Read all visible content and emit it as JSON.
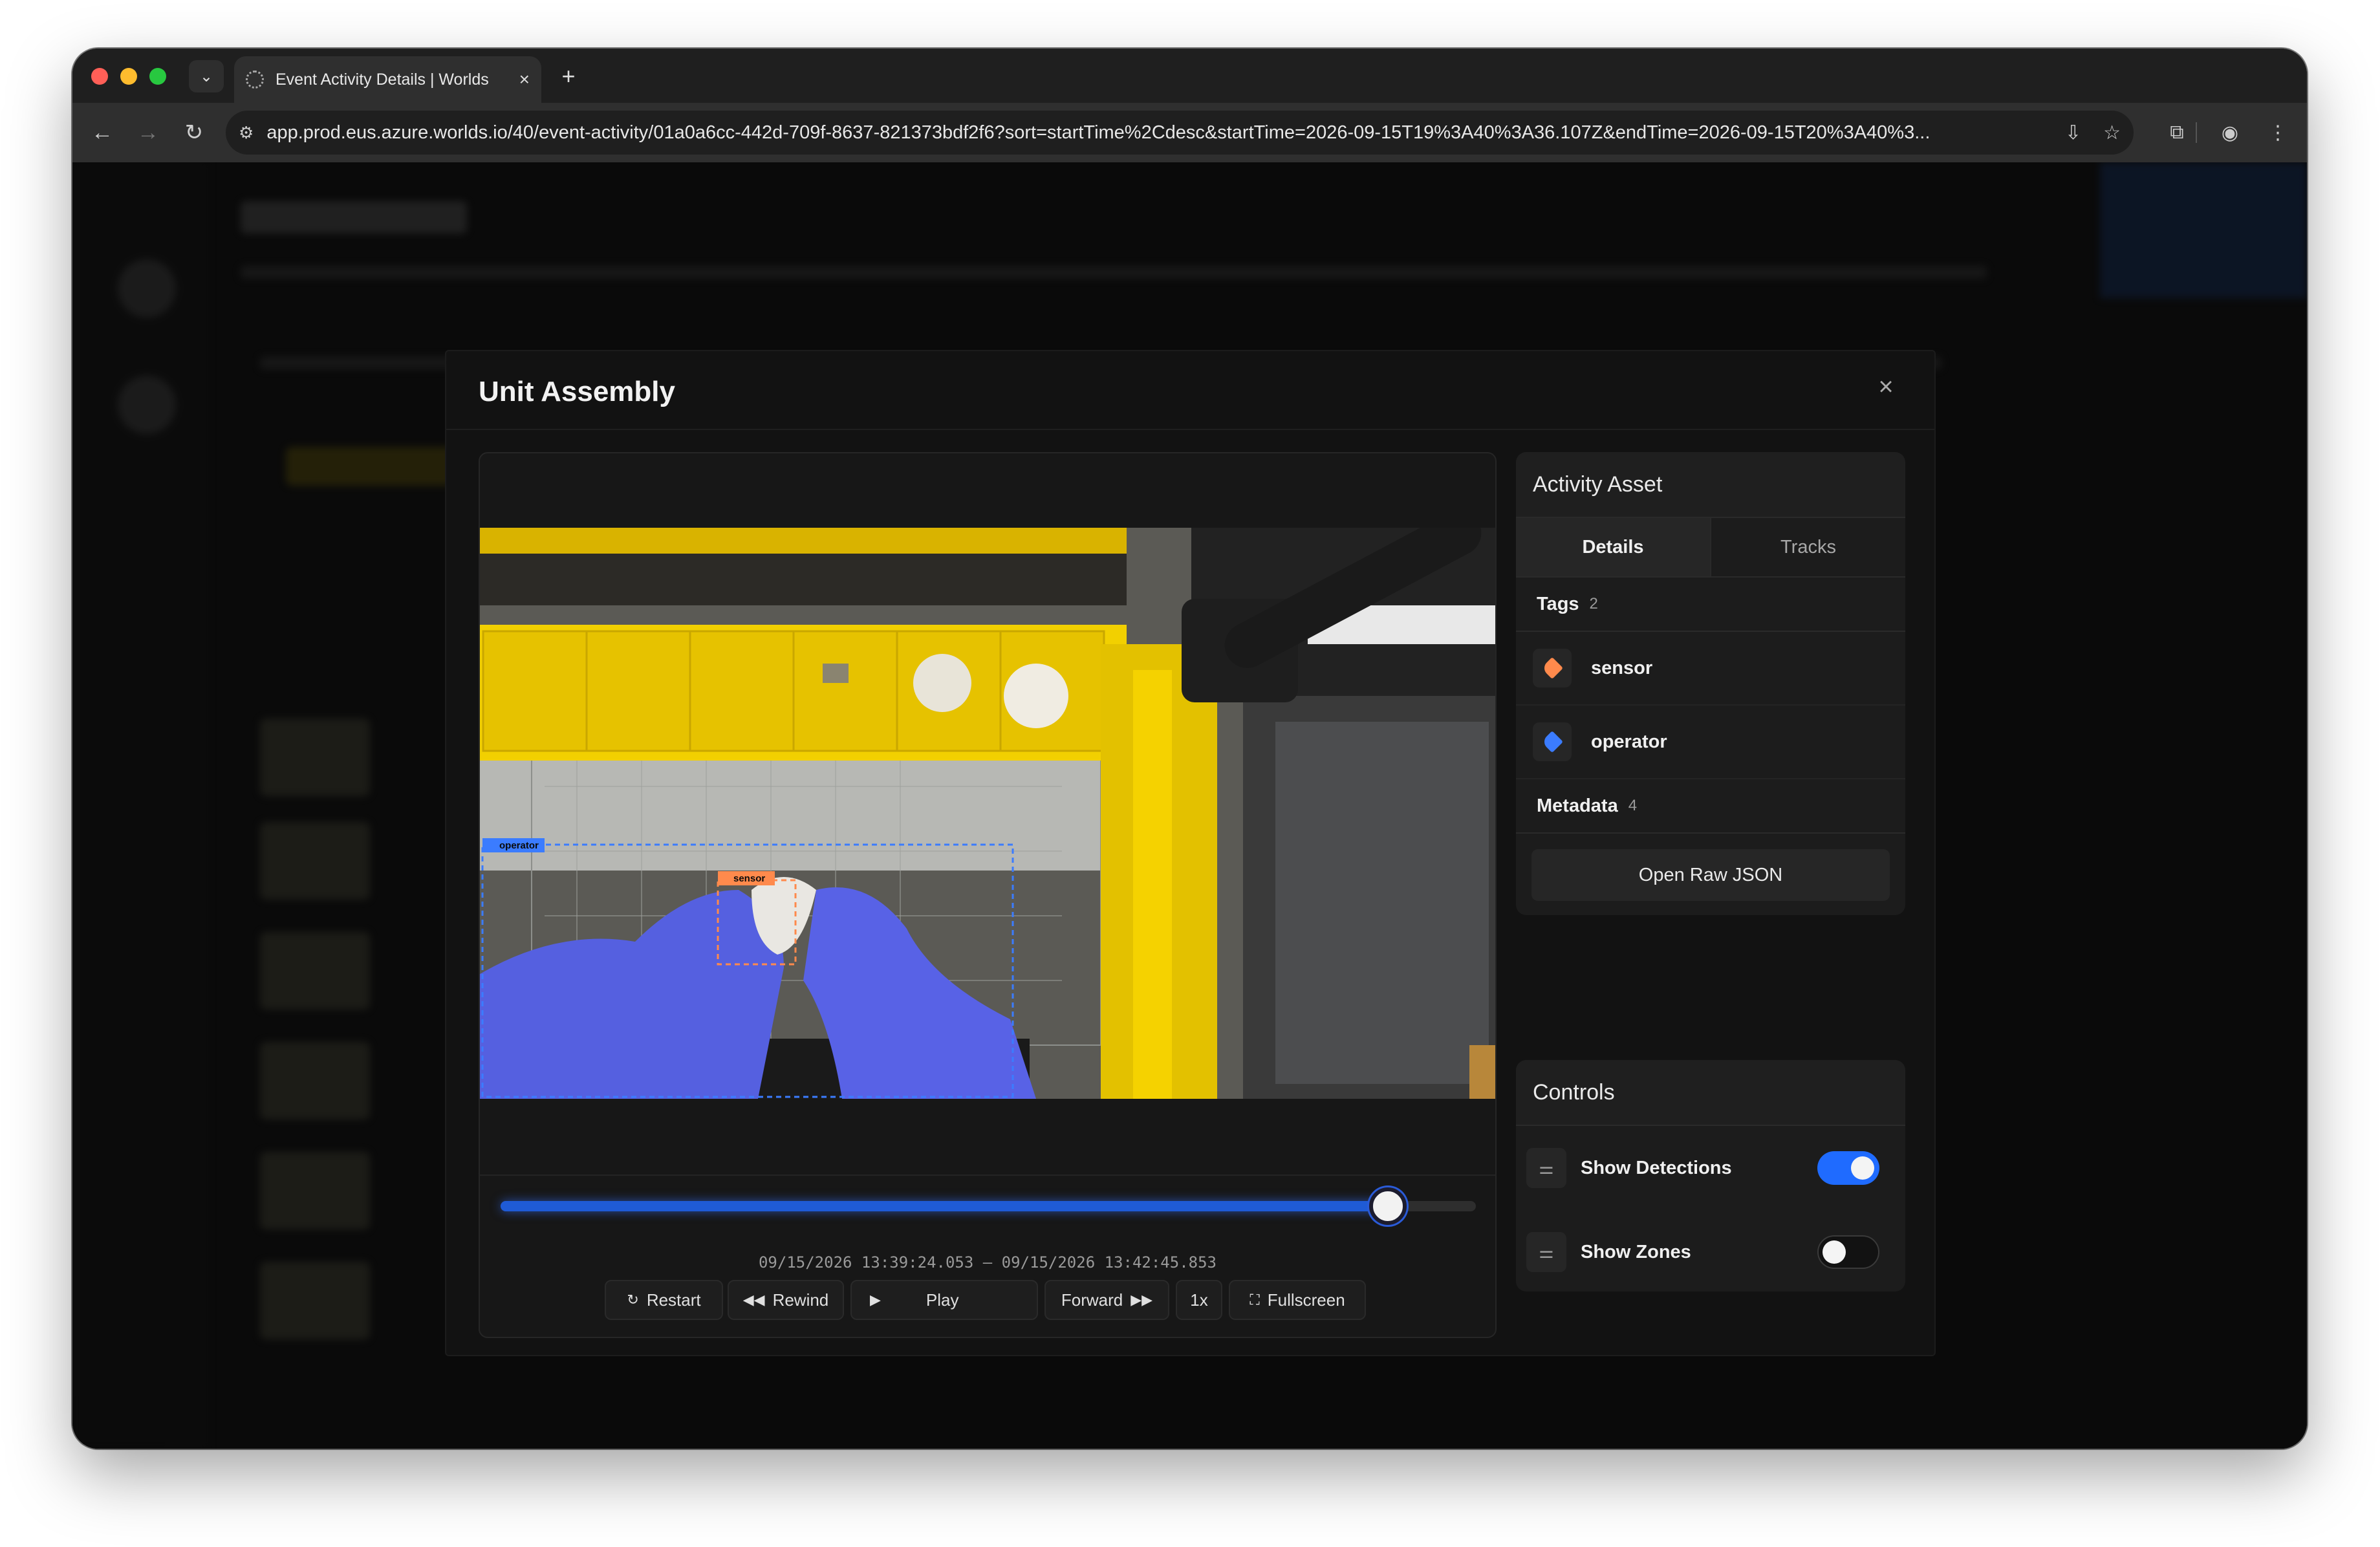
{
  "browser": {
    "tab_title": "Event Activity Details | Worlds",
    "url": "app.prod.eus.azure.worlds.io/40/event-activity/01a0a6cc-442d-709f-8637-821373bdf2f6?sort=startTime%2Cdesc&startTime=2026-09-15T19%3A40%3A36.107Z&endTime=2026-09-15T20%3A40%3..."
  },
  "modal": {
    "title": "Unit Assembly"
  },
  "video": {
    "detections": [
      {
        "label": "operator",
        "color": "#3b7cff"
      },
      {
        "label": "sensor",
        "color": "#ff8a4c"
      }
    ]
  },
  "player": {
    "progress": 0.91,
    "time_range": "09/15/2026 13:39:24.053 – 09/15/2026 13:42:45.853",
    "buttons": {
      "restart": "Restart",
      "rewind": "Rewind",
      "play": "Play",
      "forward": "Forward",
      "speed": "1x",
      "fullscreen": "Fullscreen"
    }
  },
  "asset_panel": {
    "title": "Activity Asset",
    "tabs": [
      "Details",
      "Tracks"
    ],
    "active_tab": "Details",
    "tags_label": "Tags",
    "tags_count": "2",
    "tags": [
      {
        "label": "sensor",
        "color": "#ff8a4c",
        "icon": "tag-icon"
      },
      {
        "label": "operator",
        "color": "#3b7cff",
        "icon": "tag-icon"
      }
    ],
    "metadata_label": "Metadata",
    "metadata_count": "4",
    "json_button": "Open Raw JSON"
  },
  "controls_panel": {
    "title": "Controls",
    "items": [
      {
        "label": "Show Detections",
        "enabled": true,
        "icon": "sliders-icon"
      },
      {
        "label": "Show Zones",
        "enabled": false,
        "icon": "sliders-icon"
      }
    ]
  },
  "colors": {
    "accent": "#1f6bff",
    "progress": "#1f5bd6"
  }
}
